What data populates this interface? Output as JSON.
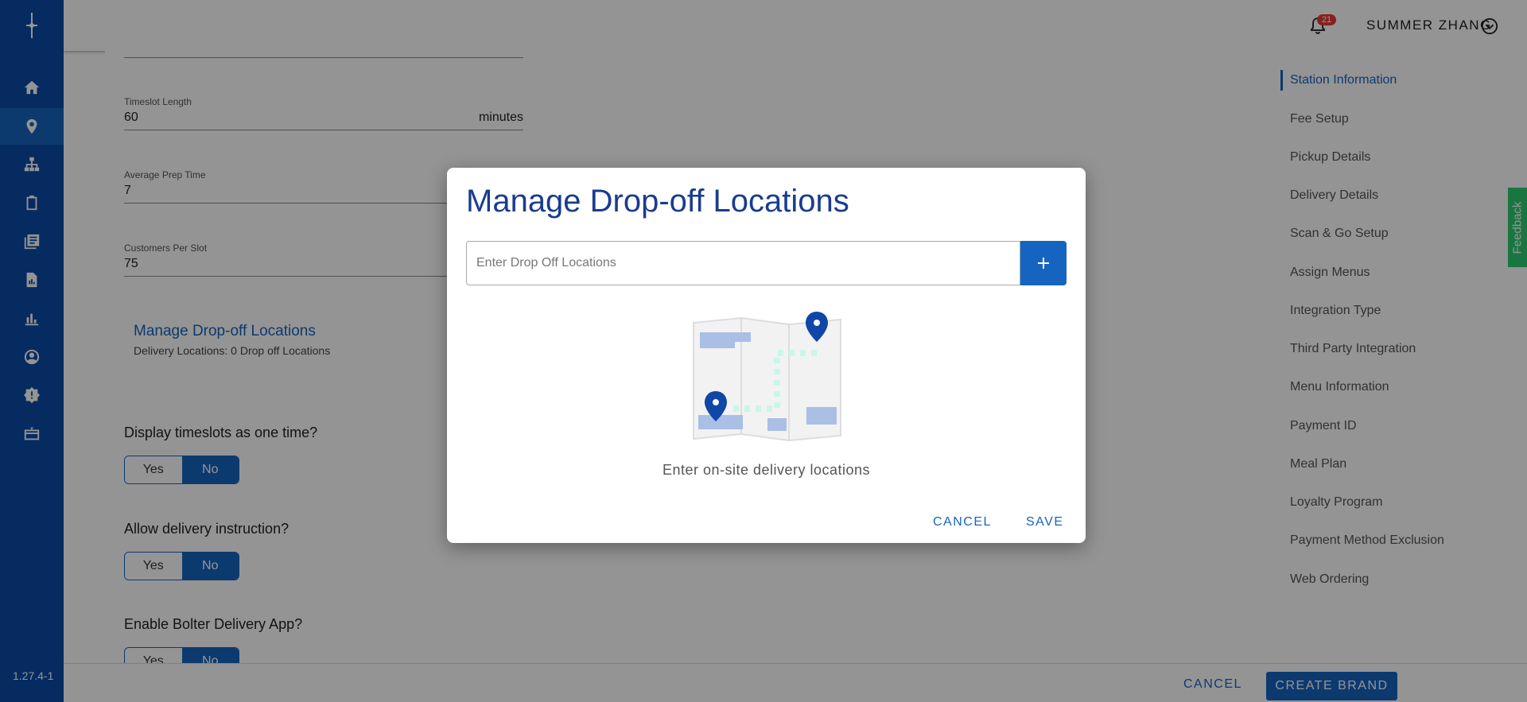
{
  "app": {
    "version": "1.27.4-1"
  },
  "leftnav": {
    "items": [
      {
        "icon": "home-icon"
      },
      {
        "icon": "location-pin-icon",
        "active": true
      },
      {
        "icon": "sitemap-icon"
      },
      {
        "icon": "clipboard-icon"
      },
      {
        "icon": "menu-book-icon"
      },
      {
        "icon": "report-document-icon"
      },
      {
        "icon": "bar-chart-icon"
      },
      {
        "icon": "account-circle-icon"
      },
      {
        "icon": "settings-badge-icon"
      },
      {
        "icon": "gift-card-icon"
      }
    ]
  },
  "header": {
    "notification_count": "21",
    "user_name": "SUMMER ZHANG"
  },
  "form": {
    "timeslot_length": {
      "label": "Timeslot Length",
      "value": "60",
      "unit": "minutes"
    },
    "avg_prep_time": {
      "label": "Average Prep Time",
      "value": "7"
    },
    "customers_per_slot": {
      "label": "Customers Per Slot",
      "value": "75"
    },
    "dropoff_link": "Manage Drop-off Locations",
    "dropoff_summary": "Delivery Locations: 0 Drop off Locations",
    "q_timeslots": "Display timeslots as one time?",
    "q_delivery_instruction": "Allow delivery instruction?",
    "q_bolter_app": "Enable Bolter Delivery App?",
    "yes": "Yes",
    "no": "No"
  },
  "rightnav": {
    "items": [
      "Station Information",
      "Fee Setup",
      "Pickup Details",
      "Delivery Details",
      "Scan & Go Setup",
      "Assign Menus",
      "Integration Type",
      "Third Party Integration",
      "Menu Information",
      "Payment ID",
      "Meal Plan",
      "Loyalty Program",
      "Payment Method Exclusion",
      "Web Ordering"
    ],
    "active_index": 0,
    "feedback": "Feedback"
  },
  "footer": {
    "cancel": "CANCEL",
    "create": "CREATE BRAND"
  },
  "modal": {
    "title": "Manage Drop-off Locations",
    "input_placeholder": "Enter Drop Off Locations",
    "input_value": "",
    "empty_text": "Enter on-site delivery locations",
    "cancel": "CANCEL",
    "save": "SAVE"
  },
  "colors": {
    "primary": "#1565c0",
    "nav_bg": "#0a4aa6",
    "title": "#1a3c8f",
    "feedback": "#2ecc71"
  }
}
